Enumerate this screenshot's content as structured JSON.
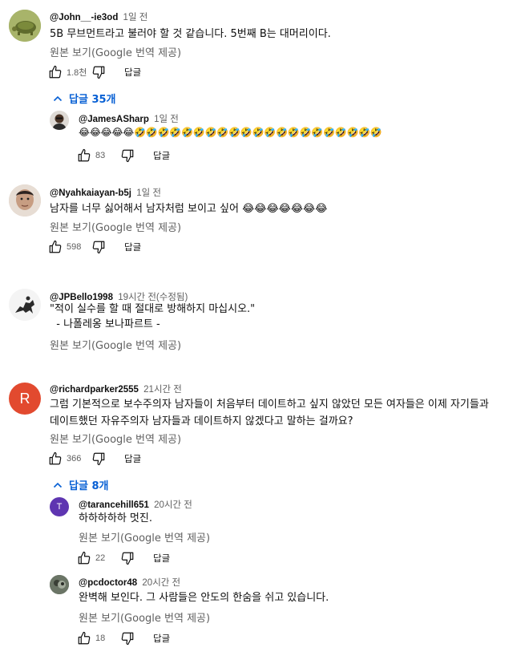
{
  "common": {
    "translate_label": "원본 보기(Google 번역 제공)",
    "reply_label": "답글"
  },
  "comments": [
    {
      "author": "@John__-ie3od",
      "time": "1일 전",
      "text": "5B 무브먼트라고 불러야 할 것 같습니다. 5번째 B는 대머리이다.",
      "likes": "1.8천",
      "avatar": "turtle",
      "avatar_color": "#7a8a3a"
    },
    {
      "replies_toggle": "답글 35개"
    },
    {
      "author": "@JamesASharp",
      "time": "1일 전",
      "text": "😂😂😂😂😂🤣🤣🤣🤣🤣🤣🤣🤣🤣🤣🤣🤣🤣🤣🤣🤣🤣🤣🤣🤣🤣",
      "likes": "83",
      "avatar": "person-dark",
      "avatar_color": "#3a2e2a"
    },
    {
      "author": "@Nyahkaiayan-b5j",
      "time": "1일 전",
      "text": "남자를 너무 싫어해서 남자처럼 보이고 싶어 😂😂😂😂😂😂😂",
      "likes": "598",
      "avatar": "person-face",
      "avatar_color": "#c9a892"
    },
    {
      "author": "@JPBello1998",
      "time": "19시간 전(수정됨)",
      "text": "\"적이 실수를 할 때 절대로 방해하지 마십시오.\"\n  - 나폴레옹 보나파르트 -",
      "avatar": "horse-rider",
      "avatar_color": "#eeeeee"
    },
    {
      "author": "@richardparker2555",
      "time": "21시간 전",
      "text": "그럼 기본적으로 보수주의자 남자들이 처음부터 데이트하고 싶지 않았던 모든 여자들은 이제 자기들과 데이트했던 자유주의자 남자들과 데이트하지 않겠다고 말하는 걸까요?",
      "likes": "366",
      "avatar": "letter",
      "avatar_letter": "R",
      "avatar_color": "#e24a2f"
    },
    {
      "replies_toggle": "답글 8개"
    },
    {
      "author": "@tarancehill651",
      "time": "20시간 전",
      "text": "하하하하하 멋진.",
      "likes": "22",
      "avatar": "letter",
      "avatar_letter": "T",
      "avatar_color": "#5e35b1"
    },
    {
      "author": "@pcdoctor48",
      "time": "20시간 전",
      "text": "완벽해 보인다. 그 사람들은 안도의 한숨을 쉬고 있습니다.",
      "likes": "18",
      "avatar": "photo",
      "avatar_color": "#4d5a4a"
    }
  ],
  "colors": {
    "link_blue": "#065fd4",
    "muted": "#606060",
    "text": "#0f0f0f"
  }
}
